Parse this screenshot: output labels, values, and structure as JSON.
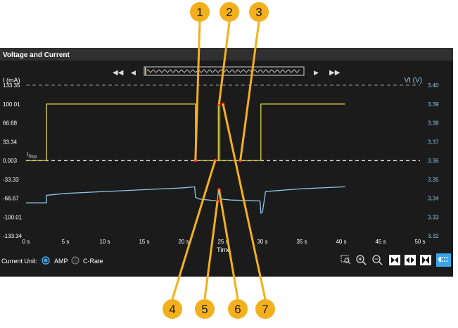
{
  "panel": {
    "title": "Voltage and Current",
    "left_axis_title": "I (mA)",
    "right_axis_title": "Vt (V)",
    "x_axis_title": "Time",
    "istop_label": "I",
    "istop_sub": "Stop"
  },
  "colors": {
    "panel_bg": "#1b1b1b",
    "title_bar": "#303030",
    "current_line": "#d9d24a",
    "voltage_line": "#8fc7e6",
    "right_axis_text": "#8fc7e6",
    "callout": "#f4b01c",
    "marker": "#ff2a2a",
    "radio_selected": "#3aa6e8",
    "toolbar_active": "#3aa6e8"
  },
  "controls": {
    "current_unit_label": "Current Unit:",
    "options": [
      "AMP",
      "C-Rate"
    ],
    "selected": "AMP"
  },
  "callouts": [
    "1",
    "2",
    "3",
    "4",
    "5",
    "6",
    "7"
  ],
  "toolbar_icons": [
    "zoom-region-icon",
    "zoom-in-icon",
    "zoom-out-icon",
    "fit-all-icon",
    "fit-horizontal-icon",
    "fit-vertical-icon",
    "cursor-active-icon"
  ],
  "chart_data": {
    "type": "line",
    "xlabel": "Time",
    "ylabel_left": "I (mA)",
    "ylabel_right": "Vt (V)",
    "xlim": [
      0,
      50
    ],
    "x_ticks": [
      "0 s",
      "5 s",
      "10 s",
      "15 s",
      "20 s",
      "25 s",
      "30 s",
      "35 s",
      "40 s",
      "45 s",
      "50 s"
    ],
    "y_left_ticks": [
      "133.35",
      "100.01",
      "66.68",
      "33.34",
      "0.003",
      "-33.33",
      "-66.67",
      "-100.01",
      "-133.34"
    ],
    "y_right_ticks": [
      "3.40",
      "3.39",
      "3.38",
      "3.37",
      "3.36",
      "3.35",
      "3.34",
      "3.33",
      "3.32"
    ],
    "ylim_left": [
      -133.34,
      133.35
    ],
    "ylim_right": [
      3.32,
      3.4
    ],
    "grid": false,
    "series": [
      {
        "name": "I (mA)",
        "axis": "left",
        "x": [
          0,
          2.6,
          2.6,
          21.5,
          21.5,
          24.4,
          24.4,
          24.6,
          24.6,
          29.8,
          29.8,
          40.5
        ],
        "y": [
          0.003,
          0.003,
          100.01,
          100.01,
          0.003,
          0.003,
          100.01,
          100.01,
          0.003,
          0.003,
          100.01,
          100.01
        ]
      },
      {
        "name": "Vt (V)",
        "axis": "right",
        "x": [
          0,
          2.6,
          2.6,
          5,
          10,
          15,
          20,
          21.4,
          21.5,
          22,
          24.3,
          24.4,
          24.6,
          24.7,
          26,
          29.7,
          29.8,
          30,
          30.4,
          35,
          40.5
        ],
        "y": [
          3.3375,
          3.3375,
          3.3415,
          3.3425,
          3.3435,
          3.3445,
          3.3455,
          3.346,
          3.3405,
          3.3395,
          3.3385,
          3.3445,
          3.344,
          3.3395,
          3.339,
          3.3385,
          3.332,
          3.3325,
          3.3435,
          3.345,
          3.346
        ]
      }
    ],
    "reference_lines": [
      {
        "axis": "left",
        "value": 133.35,
        "style": "dashed"
      },
      {
        "axis": "left",
        "value": 0.003,
        "style": "dashed",
        "label": "I Stop"
      }
    ],
    "markers": [
      {
        "id": "1",
        "x": 21.5,
        "y_left": 0.003
      },
      {
        "id": "2",
        "x": 24.5,
        "y_left": 100.01
      },
      {
        "id": "3",
        "x": 27.2,
        "y_left": 0.003
      },
      {
        "id": "4",
        "x": 24.0,
        "y_left": 0.003
      },
      {
        "id": "5",
        "x": 24.3,
        "y_right": 3.3385
      },
      {
        "id": "6",
        "x": 24.5,
        "y_right": 3.3445
      },
      {
        "id": "7",
        "x": 25.0,
        "y_left": 100.01
      }
    ]
  }
}
